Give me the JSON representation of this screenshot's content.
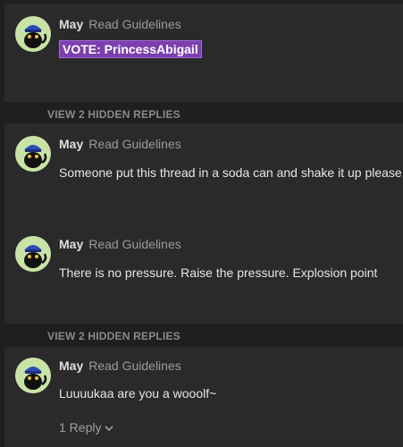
{
  "posts": [
    {
      "user": "May",
      "title": "Read Guidelines",
      "body": "VOTE: PrincessAbigail"
    },
    {
      "user": "May",
      "title": "Read Guidelines",
      "body": "Someone put this thread in a soda can and shake it up please"
    },
    {
      "user": "May",
      "title": "Read Guidelines",
      "body": "There is no pressure. Raise the pressure. Explosion point"
    },
    {
      "user": "May",
      "title": "Read Guidelines",
      "body": "Luuuukaa are you a wooolf~",
      "replies_label": "1 Reply"
    }
  ],
  "hidden_replies": [
    "VIEW 2 HIDDEN REPLIES",
    "VIEW 2 HIDDEN REPLIES"
  ],
  "colors": {
    "vote_bg": "#7b3fae",
    "avatar_bg": "#c9e3a6"
  }
}
